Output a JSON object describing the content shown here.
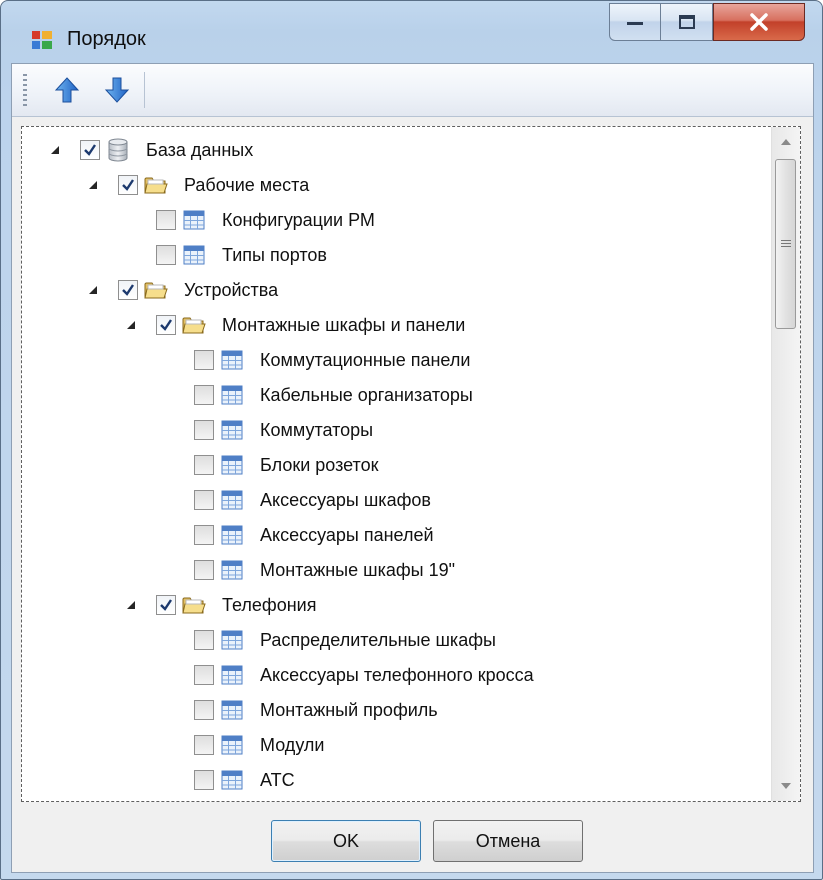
{
  "window": {
    "title": "Порядок"
  },
  "toolbar": {
    "up_icon": "arrow-up-icon",
    "down_icon": "arrow-down-icon"
  },
  "tree": {
    "items": [
      {
        "label": "База данных",
        "level": 0,
        "checked": true,
        "expandable": true,
        "icon": "database-icon"
      },
      {
        "label": "Рабочие места",
        "level": 1,
        "checked": true,
        "expandable": true,
        "icon": "folder-icon"
      },
      {
        "label": "Конфигурации РМ",
        "level": 2,
        "checked": false,
        "expandable": false,
        "icon": "table-icon"
      },
      {
        "label": "Типы портов",
        "level": 2,
        "checked": false,
        "expandable": false,
        "icon": "table-icon"
      },
      {
        "label": "Устройства",
        "level": 1,
        "checked": true,
        "expandable": true,
        "icon": "folder-icon"
      },
      {
        "label": "Монтажные шкафы и панели",
        "level": 2,
        "checked": true,
        "expandable": true,
        "icon": "folder-icon"
      },
      {
        "label": "Коммутационные панели",
        "level": 3,
        "checked": false,
        "expandable": false,
        "icon": "table-icon"
      },
      {
        "label": "Кабельные организаторы",
        "level": 3,
        "checked": false,
        "expandable": false,
        "icon": "table-icon"
      },
      {
        "label": "Коммутаторы",
        "level": 3,
        "checked": false,
        "expandable": false,
        "icon": "table-icon"
      },
      {
        "label": "Блоки розеток",
        "level": 3,
        "checked": false,
        "expandable": false,
        "icon": "table-icon"
      },
      {
        "label": "Аксессуары шкафов",
        "level": 3,
        "checked": false,
        "expandable": false,
        "icon": "table-icon"
      },
      {
        "label": "Аксессуары панелей",
        "level": 3,
        "checked": false,
        "expandable": false,
        "icon": "table-icon"
      },
      {
        "label": "Монтажные шкафы 19\"",
        "level": 3,
        "checked": false,
        "expandable": false,
        "icon": "table-icon"
      },
      {
        "label": "Телефония",
        "level": 2,
        "checked": true,
        "expandable": true,
        "icon": "folder-icon"
      },
      {
        "label": "Распределительные шкафы",
        "level": 3,
        "checked": false,
        "expandable": false,
        "icon": "table-icon"
      },
      {
        "label": "Аксессуары телефонного кросса",
        "level": 3,
        "checked": false,
        "expandable": false,
        "icon": "table-icon"
      },
      {
        "label": "Монтажный профиль",
        "level": 3,
        "checked": false,
        "expandable": false,
        "icon": "table-icon"
      },
      {
        "label": "Модули",
        "level": 3,
        "checked": false,
        "expandable": false,
        "icon": "table-icon"
      },
      {
        "label": "АТС",
        "level": 3,
        "checked": false,
        "expandable": false,
        "icon": "table-icon"
      }
    ]
  },
  "buttons": {
    "ok": "OK",
    "cancel": "Отмена"
  },
  "colors": {
    "accent": "#3c7fb1",
    "close": "#c2402a",
    "folder": "#e8c96a",
    "table": "#4f7fc6"
  }
}
